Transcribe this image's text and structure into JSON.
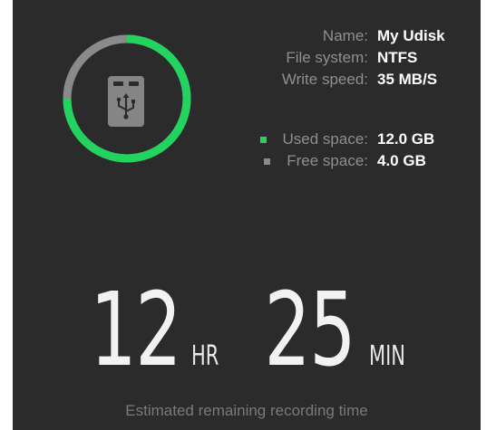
{
  "colors": {
    "panel_bg": "#2b2b2b",
    "used": "#22d35f",
    "free": "#8a8a8a",
    "icon_bg": "#858585"
  },
  "drive": {
    "icon": "usb-drive-icon",
    "name_label": "Name:",
    "name": "My Udisk",
    "fs_label": "File system:",
    "fs": "NTFS",
    "speed_label": "Write speed:",
    "speed": "35 MB/S"
  },
  "storage": {
    "used_label": "Used space:",
    "used": "12.0 GB",
    "free_label": "Free space:",
    "free": "4.0 GB",
    "used_fraction": 0.75
  },
  "timer": {
    "hours": "12",
    "hours_unit": "HR",
    "minutes": "25",
    "minutes_unit": "MIN",
    "caption": "Estimated remaining recording time"
  }
}
